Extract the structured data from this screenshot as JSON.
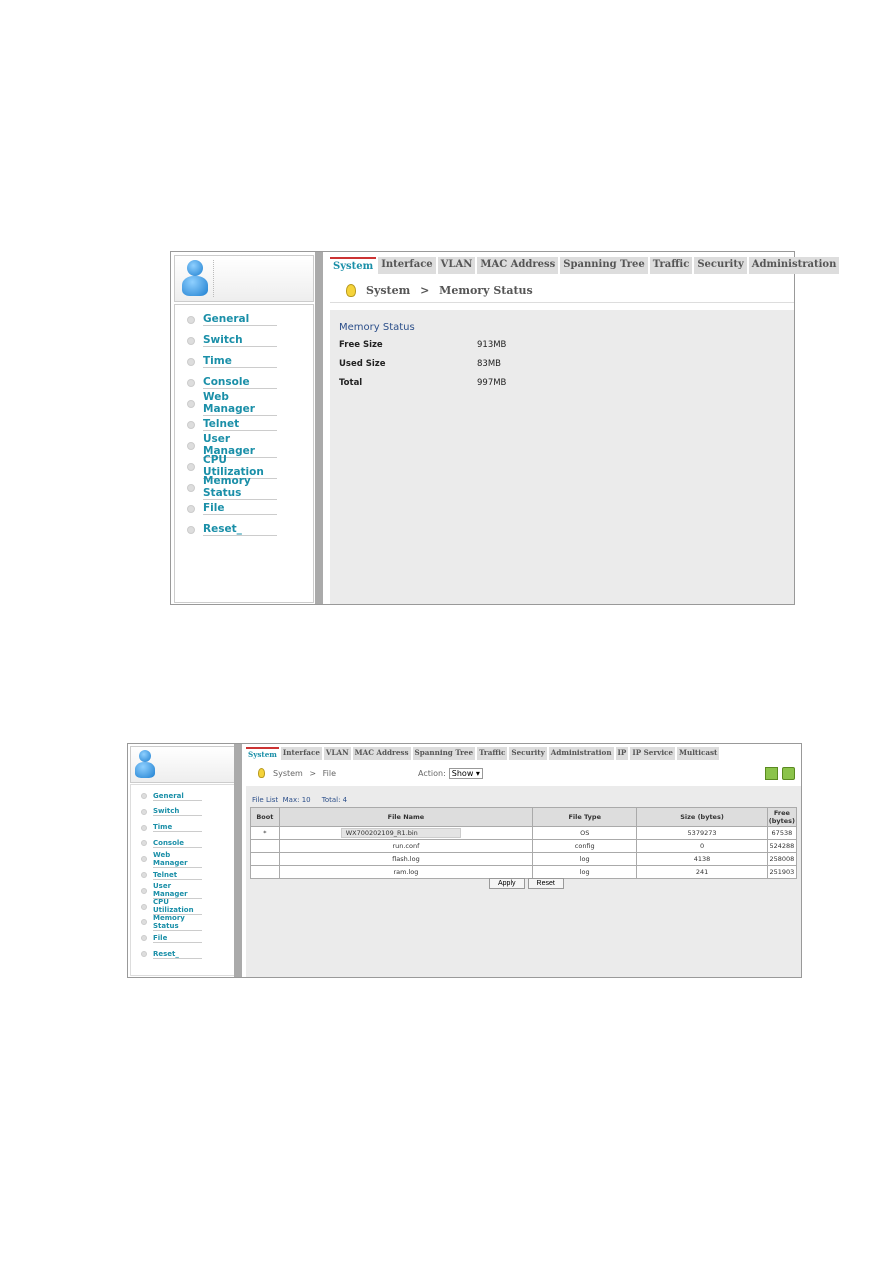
{
  "sidebar_items": [
    "General",
    "Switch",
    "Time",
    "Console",
    "Web Manager",
    "Telnet",
    "User Manager",
    "CPU Utilization",
    "Memory Status",
    "File",
    "Reset_"
  ],
  "shot1": {
    "tabs": [
      "System",
      "Interface",
      "VLAN",
      "MAC Address",
      "Spanning Tree",
      "Traffic",
      "Security",
      "Administration"
    ],
    "crumb": {
      "root": "System",
      "sep": ">",
      "page": "Memory Status"
    },
    "section_title": "Memory Status",
    "rows": [
      {
        "label": "Free Size",
        "value": "913MB"
      },
      {
        "label": "Used Size",
        "value": "83MB"
      },
      {
        "label": "Total",
        "value": "997MB"
      }
    ]
  },
  "shot2": {
    "tabs": [
      "System",
      "Interface",
      "VLAN",
      "MAC Address",
      "Spanning Tree",
      "Traffic",
      "Security",
      "Administration",
      "IP",
      "IP Service",
      "Multicast"
    ],
    "crumb": {
      "root": "System",
      "sep": ">",
      "page": "File"
    },
    "action_label": "Action:",
    "action_value": "Show",
    "file_list": {
      "label": "File List",
      "max": "Max: 10",
      "total": "Total: 4"
    },
    "columns": [
      "Boot",
      "File Name",
      "File Type",
      "Size (bytes)",
      "Free (bytes)"
    ],
    "rows": [
      [
        "*",
        "WX700202109_R1.bin",
        "OS",
        "5379273",
        "67538"
      ],
      [
        "",
        "run.conf",
        "config",
        "0",
        "524288"
      ],
      [
        "",
        "flash.log",
        "log",
        "4138",
        "258008"
      ],
      [
        "",
        "ram.log",
        "log",
        "241",
        "251903"
      ]
    ],
    "apply": "Apply",
    "reset": "Reset"
  },
  "accent": "#1a8fa8"
}
